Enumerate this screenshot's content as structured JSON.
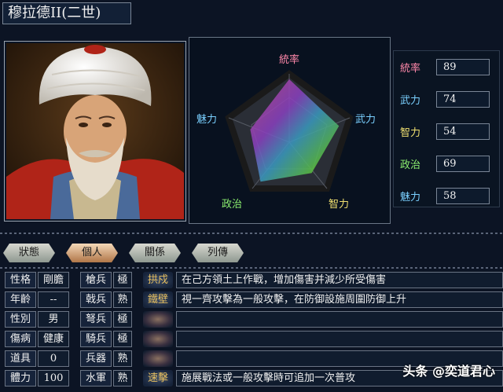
{
  "title": "穆拉德II(二世)",
  "radar": {
    "axes": [
      "統率",
      "武力",
      "智力",
      "政治",
      "魅力"
    ],
    "axis_colors": [
      "#ff88aa",
      "#7ad0ff",
      "#f0e070",
      "#8cf070",
      "#7ad0ff"
    ]
  },
  "stats": [
    {
      "label": "統率",
      "value": "89",
      "color": "#ff88aa"
    },
    {
      "label": "武力",
      "value": "74",
      "color": "#7ad0ff"
    },
    {
      "label": "智力",
      "value": "54",
      "color": "#f0e070"
    },
    {
      "label": "政治",
      "value": "69",
      "color": "#8cf070"
    },
    {
      "label": "魅力",
      "value": "58",
      "color": "#7ad0ff"
    }
  ],
  "tabs": [
    "狀態",
    "個人",
    "關係",
    "列傳"
  ],
  "active_tab": "個人",
  "profile": [
    {
      "label": "性格",
      "value": "剛膽"
    },
    {
      "label": "年齡",
      "value": "--"
    },
    {
      "label": "性別",
      "value": "男"
    },
    {
      "label": "傷病",
      "value": "健康"
    },
    {
      "label": "道具",
      "value": "0"
    },
    {
      "label": "體力",
      "value": "100"
    }
  ],
  "aptitude": [
    {
      "label": "槍兵",
      "value": "極"
    },
    {
      "label": "戟兵",
      "value": "熟"
    },
    {
      "label": "弩兵",
      "value": "極"
    },
    {
      "label": "騎兵",
      "value": "極"
    },
    {
      "label": "兵器",
      "value": "熟"
    },
    {
      "label": "水軍",
      "value": "熟"
    }
  ],
  "skills": [
    {
      "name": "拱戍",
      "desc": "在己方領土上作戰，增加傷害并減少所受傷害"
    },
    {
      "name": "鐵壁",
      "desc": "視一齊攻擊為一般攻擊，在防御設施周圍防御上升"
    },
    {
      "name": "",
      "desc": ""
    },
    {
      "name": "",
      "desc": ""
    },
    {
      "name": "",
      "desc": ""
    },
    {
      "name": "速擊",
      "desc": "施展戰法或一般攻擊時可追加一次普攻"
    }
  ],
  "watermark": "头条 @奕道君心"
}
